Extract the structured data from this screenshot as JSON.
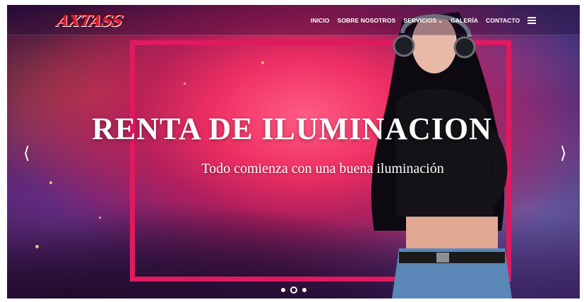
{
  "brand": {
    "logo_text": "AXTASS"
  },
  "nav": {
    "items": [
      {
        "label": "INICIO"
      },
      {
        "label": "SOBRE NOSOTROS"
      },
      {
        "label": "SERVICIOS",
        "has_dropdown": true
      },
      {
        "label": "GALERÍA"
      },
      {
        "label": "CONTACTO"
      }
    ],
    "menu_icon": "hamburger-icon"
  },
  "hero": {
    "headline": "RENTA DE ILUMINACION",
    "subheadline": "Todo comienza con una buena iluminación",
    "prev_icon": "chevron-left-icon",
    "next_icon": "chevron-right-icon",
    "frame_color": "#e01a5e",
    "slides": {
      "count": 3,
      "active_index": 1
    }
  }
}
